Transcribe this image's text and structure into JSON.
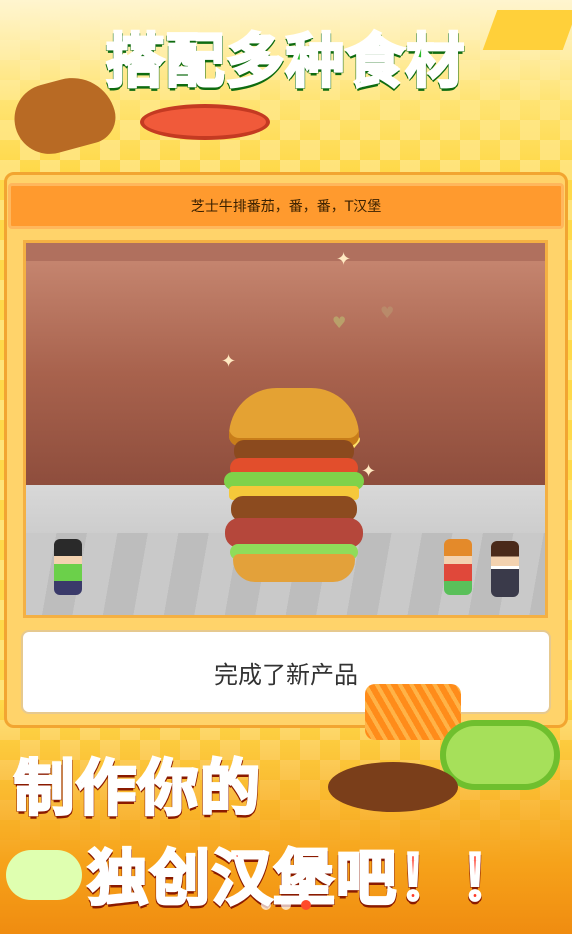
{
  "headline_top": "搭配多种食材",
  "recipe_title": "芝士牛排番茄，番，番，T汉堡",
  "message": "完成了新产品",
  "headline_bottom_line1": "制作你的",
  "headline_bottom_line2": "独创汉堡吧！！",
  "carousel": {
    "pages": 3,
    "active": 3
  },
  "colors": {
    "headline_green": "#29b929",
    "headline_red": "#ff3a2a",
    "panel_orange": "#ff9a2e"
  }
}
